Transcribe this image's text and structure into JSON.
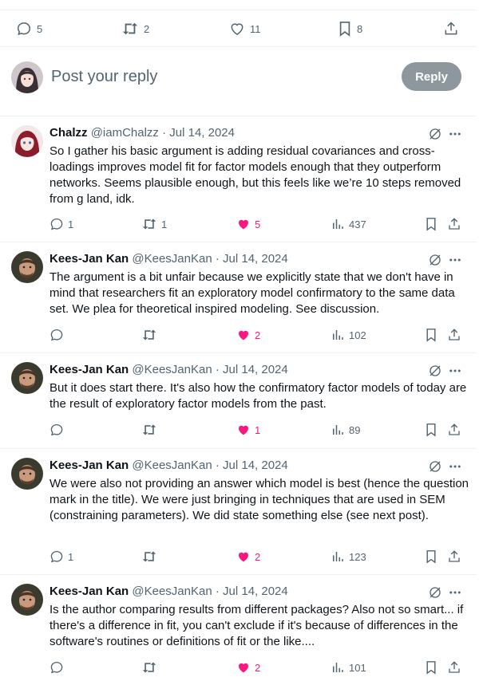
{
  "top_actions": {
    "replies": "5",
    "reposts": "2",
    "likes": "11",
    "bookmarks": "8"
  },
  "compose": {
    "placeholder": "Post your reply",
    "reply_label": "Reply"
  },
  "tweets": [
    {
      "name": "Chalzz",
      "meta": "@iamChalzz · Jul 14, 2024",
      "text": "So I gather his basic argument is adding residual covariances and cross-loadings improves model fit for factor models enough that they outperform networks. Seems plausible enough, but this feels like we’re 10 steps removed from g land, idk.",
      "replies": "1",
      "reposts": "1",
      "likes": "5",
      "views": "437"
    },
    {
      "name": "Kees-Jan Kan",
      "meta": "@KeesJanKan · Jul 14, 2024",
      "text": "The argument is a bit unfair because we explicitly state that we don't have in mind that researchers fit an exploratory model confirmatory to the same data set. We plea for theoretical inspired modeling. See discussion.",
      "replies": "",
      "reposts": "",
      "likes": "2",
      "views": "102"
    },
    {
      "name": "Kees-Jan Kan",
      "meta": "@KeesJanKan · Jul 14, 2024",
      "text": "But it does start there. It's also how the confirmatory factor models of today are the result of exploratory factor models from the past.",
      "replies": "",
      "reposts": "",
      "likes": "1",
      "views": "89"
    },
    {
      "name": "Kees-Jan Kan",
      "meta": "@KeesJanKan · Jul 14, 2024",
      "text": "We were also not providing an answer which model is best (hence the question mark in the title). We were just bringing in techniques that are used in SEM (constraining parameters). We did state something else (see next post).",
      "replies": "1",
      "reposts": "",
      "likes": "2",
      "views": "123"
    },
    {
      "name": "Kees-Jan Kan",
      "meta": "@KeesJanKan · Jul 14, 2024",
      "text": "Is the author comparing results from different packages? Also not so smart... if there's a difference in fit, you can't exclude if it's because of differences in the software's routines or definitions of fit or the like....",
      "replies": "",
      "reposts": "",
      "likes": "2",
      "views": "101"
    }
  ],
  "colors": {
    "like": "#f91880",
    "muted": "#536471",
    "text": "#0f1419",
    "reply_button": "#8d979e"
  }
}
